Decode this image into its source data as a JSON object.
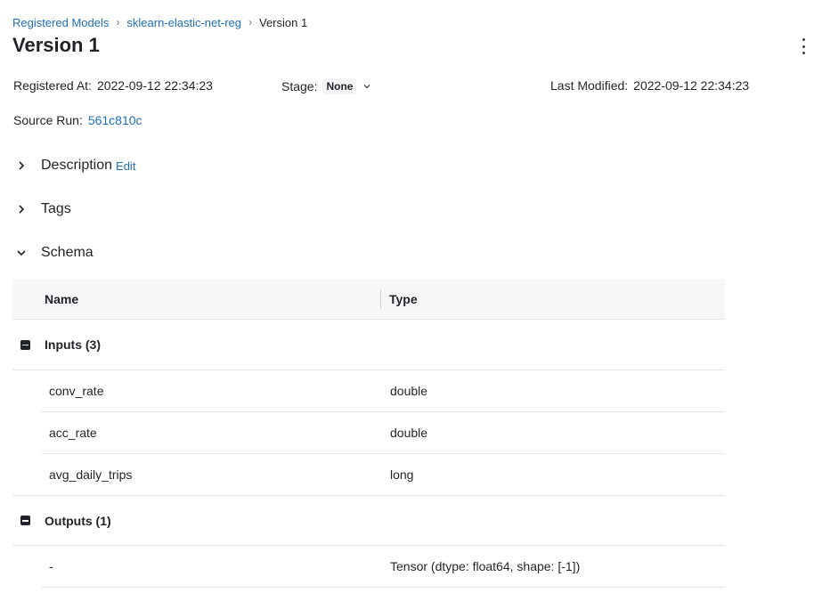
{
  "breadcrumb": {
    "registered_models": "Registered Models",
    "model_name": "sklearn-elastic-net-reg",
    "current": "Version 1"
  },
  "page_title": "Version 1",
  "meta": {
    "registered_at_label": "Registered At:",
    "registered_at_value": "2022-09-12 22:34:23",
    "stage_label": "Stage:",
    "stage_value": "None",
    "last_modified_label": "Last Modified:",
    "last_modified_value": "2022-09-12 22:34:23",
    "source_run_label": "Source Run:",
    "source_run_value": "561c810c"
  },
  "sections": {
    "description": "Description",
    "description_edit": "Edit",
    "tags": "Tags",
    "schema": "Schema"
  },
  "schema_table": {
    "headers": {
      "name": "Name",
      "type": "Type"
    },
    "inputs_label": "Inputs (3)",
    "inputs": [
      {
        "name": "conv_rate",
        "type": "double"
      },
      {
        "name": "acc_rate",
        "type": "double"
      },
      {
        "name": "avg_daily_trips",
        "type": "long"
      }
    ],
    "outputs_label": "Outputs (1)",
    "outputs": [
      {
        "name": "-",
        "type": "Tensor (dtype: float64, shape: [-1])"
      }
    ]
  },
  "colors": {
    "link": "#1f6fb5",
    "text": "#1f2328",
    "header_bg": "#f6f7f9"
  },
  "icons": [
    "chevron-right-icon",
    "chevron-down-icon",
    "kebab-menu-icon",
    "collapse-minus-icon"
  ]
}
